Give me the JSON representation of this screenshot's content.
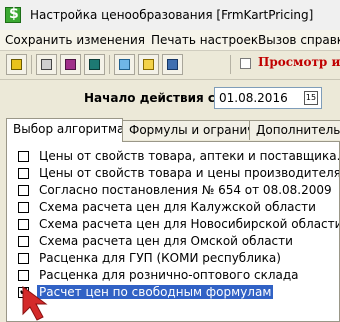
{
  "window": {
    "title": "Настройка ценообразования [FrmKartPricing]"
  },
  "menu": [
    "Сохранить изменения",
    "Печать настроек",
    "Вызов справки"
  ],
  "toolbar": {
    "buttons": [
      "save-icon",
      "print-icon",
      "book-icon",
      "calculator-icon",
      "export-icon",
      "import-icon",
      "exit-door-icon"
    ],
    "preview_label": "Просмотр ист"
  },
  "start": {
    "label": "Начало действия с",
    "date": "01.08.2016",
    "calendar_glyph": "15"
  },
  "tabs": [
    "Выбор алгоритма",
    "Формулы и ограничения",
    "Дополнительно"
  ],
  "algorithms": [
    {
      "label": "Цены от свойств товара, аптеки и поставщика.",
      "checked": false,
      "selected": false
    },
    {
      "label": "Цены от свойств товара и цены производителя",
      "checked": false,
      "selected": false
    },
    {
      "label": "Согласно постановления № 654 от 08.08.2009",
      "checked": false,
      "selected": false
    },
    {
      "label": "Схема расчета цен для Калужской области",
      "checked": false,
      "selected": false
    },
    {
      "label": "Схема расчета цен для Новосибирской области",
      "checked": false,
      "selected": false
    },
    {
      "label": "Схема расчета цен для Омской области",
      "checked": false,
      "selected": false
    },
    {
      "label": "Расценка для ГУП (КОМИ республика)",
      "checked": false,
      "selected": false
    },
    {
      "label": "Расценка для рознично-оптового склада",
      "checked": false,
      "selected": false
    },
    {
      "label": "Расчет цен по свободным формулам",
      "checked": true,
      "selected": true
    }
  ],
  "colors": {
    "selection": "#3162c5",
    "accent_red": "#c00000",
    "arrow": "#d42a2a"
  }
}
